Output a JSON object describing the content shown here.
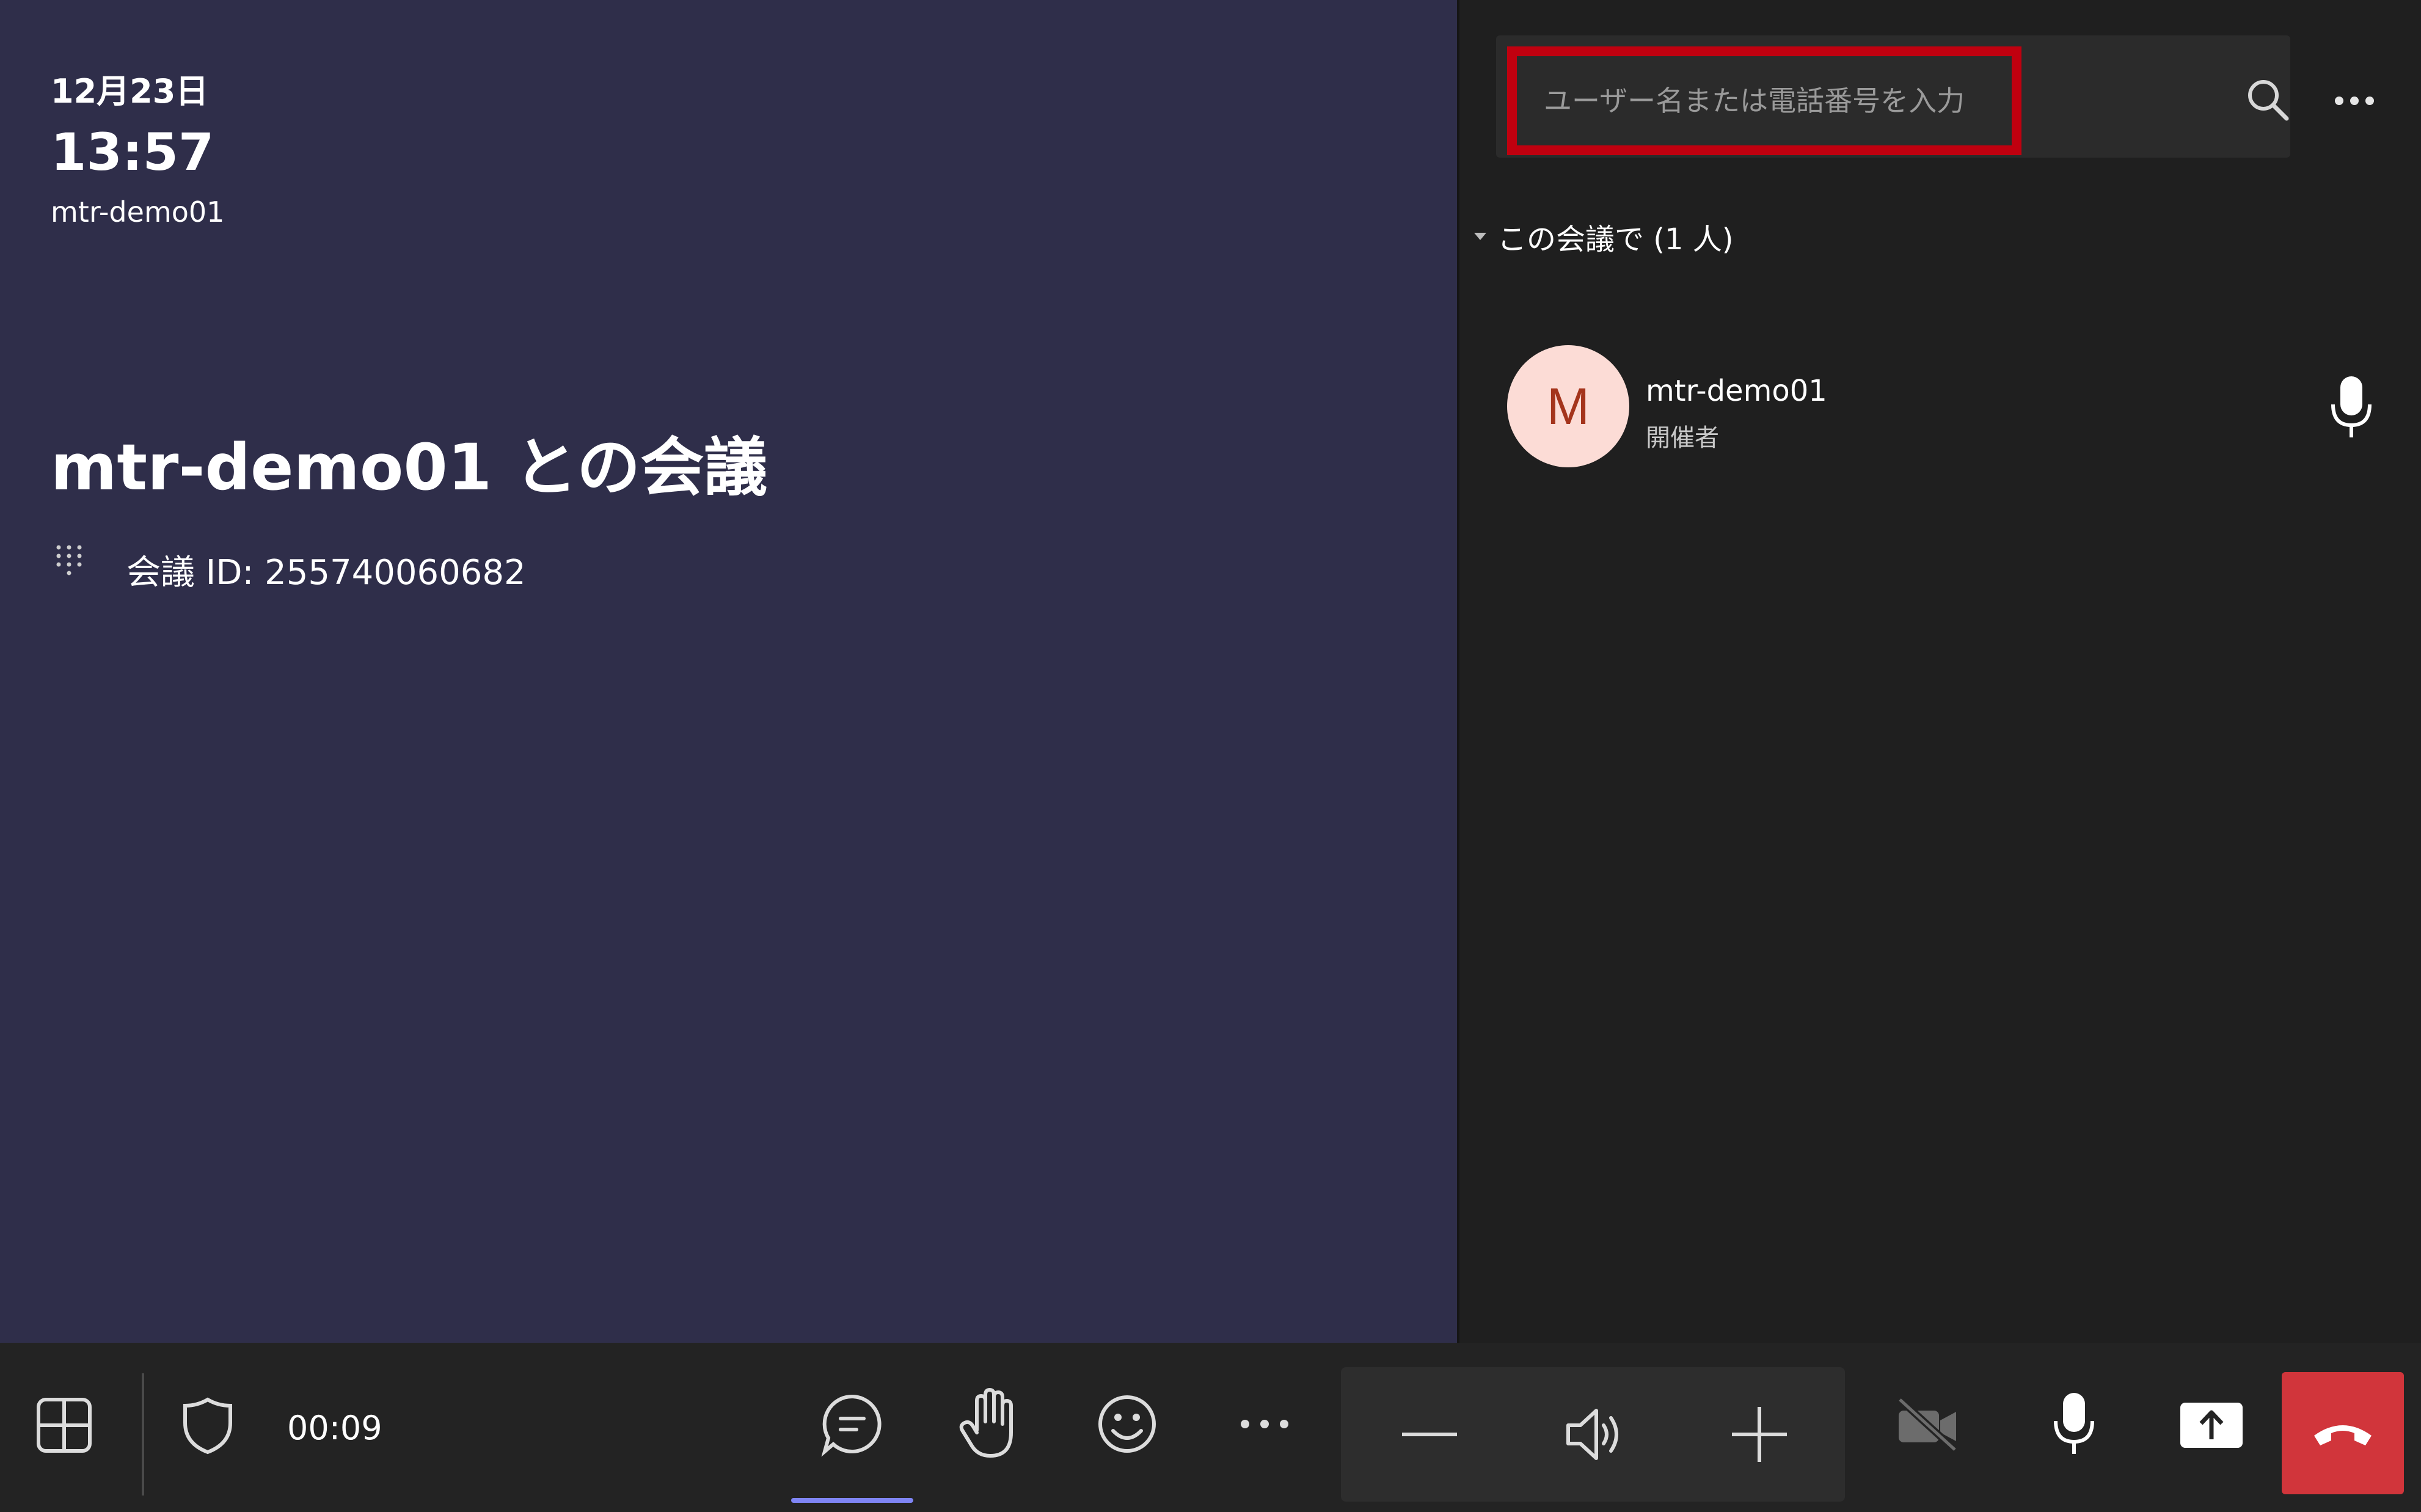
{
  "meeting_info": {
    "date": "12月23日",
    "time": "13:57",
    "device_name": "mtr-demo01",
    "title": "mtr-demo01 との会議",
    "meeting_id_text": "会議 ID: 255740060682"
  },
  "people_panel": {
    "search_placeholder": "ユーザー名または電話番号を入力",
    "section_header": "この会議で (1 人)",
    "participants": [
      {
        "initial": "M",
        "name": "mtr-demo01",
        "role": "開催者"
      }
    ]
  },
  "toolbar": {
    "timer": "00:09",
    "icons": [
      "layout-icon",
      "shield-icon",
      "chat-icon",
      "raise-hand-icon",
      "smiley-icon",
      "more-icon",
      "minus-icon",
      "speaker-icon",
      "plus-icon",
      "camera-off-icon",
      "microphone-icon",
      "share-icon",
      "hangup-icon"
    ]
  },
  "colors": {
    "left_pane_bg": "#2f2e4a",
    "right_pane_bg": "#1f1f1f",
    "toolbar_bg": "#232323",
    "highlight_border": "#c0000f",
    "hangup_red": "#d1353b",
    "avatar_bg": "#fcdcd6",
    "avatar_text": "#a4341c",
    "active_underline": "#7f85f5"
  }
}
